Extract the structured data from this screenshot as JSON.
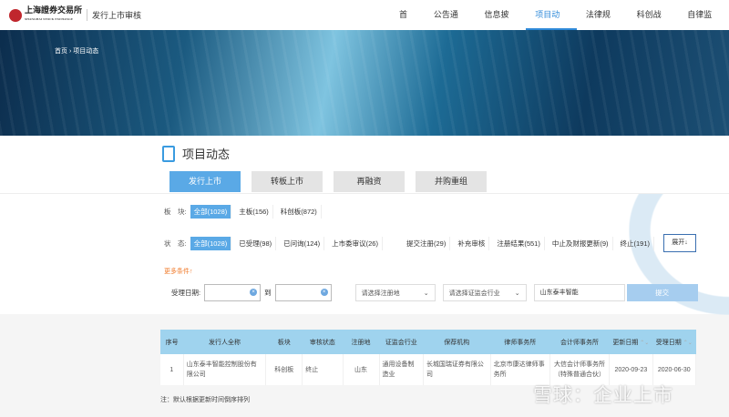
{
  "header": {
    "logo_text": "上海證券交易所",
    "logo_sub": "SHANGHAI STOCK EXCHANGE",
    "system": "发行上市审核",
    "nav": [
      {
        "label": "首页"
      },
      {
        "label": "公告通知"
      },
      {
        "label": "信息披露"
      },
      {
        "label": "项目动态",
        "active": true
      },
      {
        "label": "法律规则"
      },
      {
        "label": "科创战略"
      },
      {
        "label": "自律监管"
      }
    ]
  },
  "breadcrumb": {
    "home": "首页",
    "sep": "›",
    "current": "项目动态"
  },
  "page_title": "项目动态",
  "tabs": [
    "发行上市",
    "转板上市",
    "再融资",
    "并购重组"
  ],
  "board": {
    "label": "板　块:",
    "options": [
      "全部(1028)",
      "主板(156)",
      "科创板(872)"
    ]
  },
  "status": {
    "label": "状　态:",
    "options": [
      "全部(1028)",
      "已受理(98)",
      "已问询(124)",
      "上市委审议(26)",
      "提交注册(29)",
      "补充审核",
      "注册结果(551)",
      "中止及财报更新(9)",
      "终止(191)"
    ],
    "expand": "展开↓"
  },
  "more_conditions": "更多条件↑",
  "query": {
    "date_label": "受理日期:",
    "to": "到",
    "region_placeholder": "请选择注册地",
    "industry_placeholder": "请选择证监会行业",
    "keyword": "山东泰丰智能",
    "submit": "提交"
  },
  "table": {
    "headers": [
      "序号",
      "发行人全称",
      "板块",
      "审核状态",
      "注册地",
      "证监会行业",
      "保荐机构",
      "律师事务所",
      "会计师事务所",
      "更新日期",
      "受理日期"
    ],
    "rows": [
      [
        "1",
        "山东泰丰智能控制股份有限公司",
        "科创板",
        "终止",
        "山东",
        "通用设备制造业",
        "长城国瑞证券有限公司",
        "北京市康达律师事务所",
        "大信会计师事务所（特殊普通合伙）",
        "2020-09-23",
        "2020-06-30"
      ]
    ]
  },
  "note": "注：默认根据更新时间倒序排列",
  "watermark": "雪球：企业上市"
}
